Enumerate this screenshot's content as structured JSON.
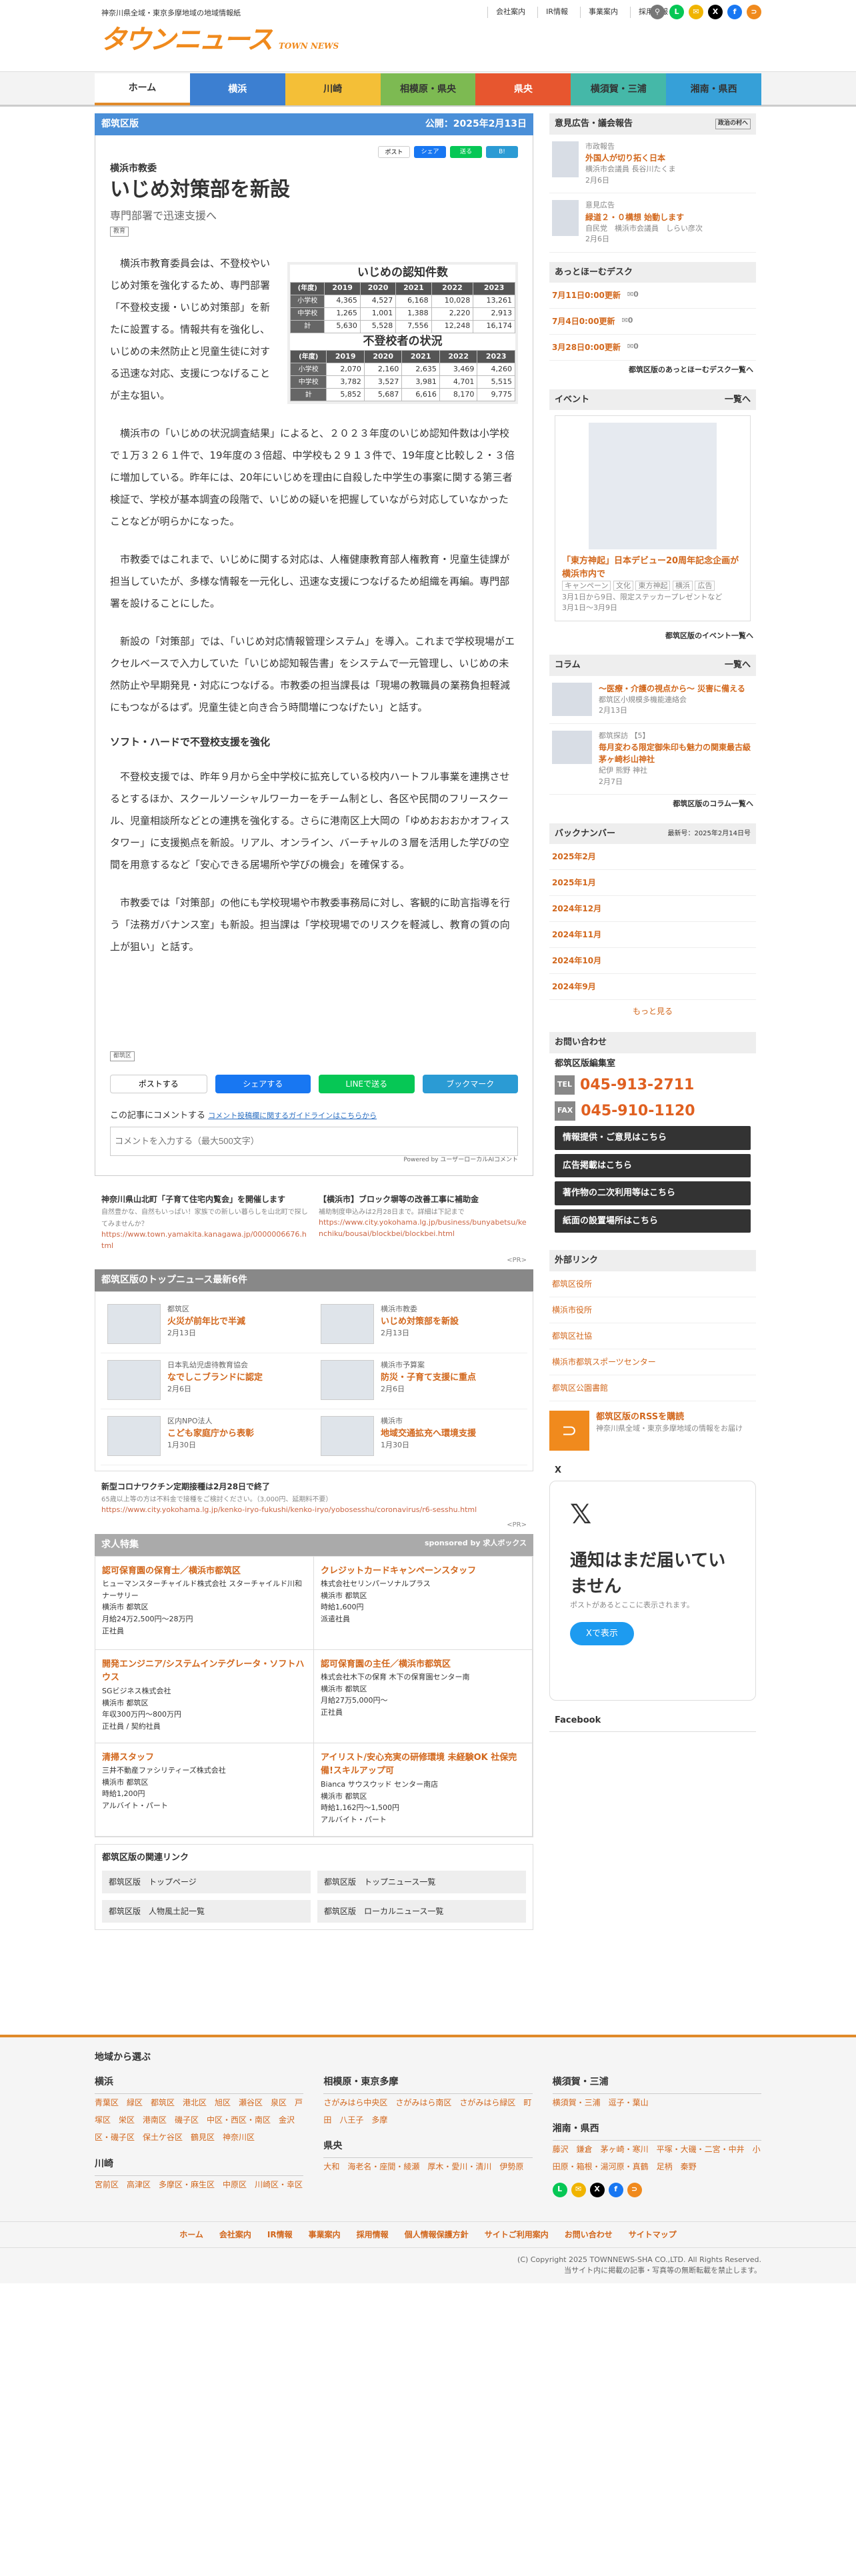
{
  "site": {
    "tagline": "神奈川県全域・東京多摩地域の地域情報紙",
    "logo": "タウンニュース",
    "logo_sub": "TOWN NEWS"
  },
  "toplinks": [
    "会社案内",
    "IR情報",
    "事業案内",
    "採用情報"
  ],
  "nav": [
    "ホーム",
    "横浜",
    "川崎",
    "相模原・県央",
    "県央",
    "横須賀・三浦",
    "湘南・県西"
  ],
  "nav_colors": [
    "#ffffff",
    "#3c7fd1",
    "#f4bf37",
    "#7dba52",
    "#e7562f",
    "#45b8a8",
    "#36a0d8"
  ],
  "article": {
    "edition": "都筑区版",
    "published": "公開：2025年2月13日",
    "share_small": [
      "ポスト",
      "シェア",
      "送る",
      "B!"
    ],
    "kicker": "横浜市教委",
    "title": "いじめ対策部を新設",
    "subtitle": "専門部署で迅速支援へ",
    "badge": "教育",
    "p1": "横浜市教育委員会は、不登校やいじめ対策を強化するため、専門部署「不登校支援・いじめ対策部」を新たに設置する。情報共有を強化し、いじめの未然防止と児童生徒に対する迅速な対応、支援につなげることが主な狙い。",
    "p2": "横浜市の「いじめの状況調査結果」によると、２０２３年度のいじめ認知件数は小学校で１万３２６１件で、19年度の３倍超、中学校も２９１３件で、19年度と比較し２・３倍に増加している。昨年には、20年にいじめを理由に自殺した中学生の事案に関する第三者検証で、学校が基本調査の段階で、いじめの疑いを把握していながら対応していなかったことなどが明らかになった。",
    "p3": "市教委ではこれまで、いじめに関する対応は、人権健康教育部人権教育・児童生徒課が担当していたが、多様な情報を一元化し、迅速な支援につなげるため組織を再編。専門部署を設けることにした。",
    "p4": "新設の「対策部」では、「いじめ対応情報管理システム」を導入。これまで学校現場がエクセルベースで入力していた「いじめ認知報告書」をシステムで一元管理し、いじめの未然防止や早期発見・対応につなげる。市教委の担当課長は「現場の教職員の業務負担軽減にもつながるはず。児童生徒と向き合う時間増につなげたい」と話す。",
    "h3": "ソフト・ハードで不登校支援を強化",
    "p5": "不登校支援では、昨年９月から全中学校に拡充している校内ハートフル事業を連携させるとするほか、スクールソーシャルワーカーをチーム制とし、各区や民間のフリースクール、児童相談所などとの連携を強化する。さらに港南区上大岡の「ゆめおおおかオフィスタワー」に支援拠点を新設。リアル、オンライン、バーチャルの３層を活用した学びの空間を用意するなど「安心できる居場所や学びの機会」を確保する。",
    "p6": "市教委では「対策部」の他にも学校現場や市教委事務局に対し、客観的に助言指導を行う「法務ガバナンス室」も新設。担当課は「学校現場でのリスクを軽減し、教育の質の向上が狙い」と話す。",
    "area_tag": "都筑区",
    "share_big": [
      "ポストする",
      "シェアする",
      "LINEで送る",
      "ブックマーク"
    ],
    "comment_label": "この記事にコメントする",
    "comment_link": "コメント投稿欄に関するガイドラインはこちらから",
    "comment_placeholder": "コメントを入力する（最大500文字）",
    "powered": "Powered by ユーザーローカルAIコメント"
  },
  "figure": {
    "title1": "いじめの認知件数",
    "title2": "不登校者の状況",
    "years": [
      "(年度)",
      "2019",
      "2020",
      "2021",
      "2022",
      "2023"
    ],
    "t1": [
      [
        "小学校",
        "4,365",
        "4,527",
        "6,168",
        "10,028",
        "13,261"
      ],
      [
        "中学校",
        "1,265",
        "1,001",
        "1,388",
        "2,220",
        "2,913"
      ],
      [
        "計",
        "5,630",
        "5,528",
        "7,556",
        "12,248",
        "16,174"
      ]
    ],
    "t2": [
      [
        "小学校",
        "2,070",
        "2,160",
        "2,635",
        "3,469",
        "4,260"
      ],
      [
        "中学校",
        "3,782",
        "3,527",
        "3,981",
        "4,701",
        "5,515"
      ],
      [
        "計",
        "5,852",
        "5,687",
        "6,616",
        "8,170",
        "9,775"
      ]
    ]
  },
  "ads": [
    {
      "title": "神奈川県山北町「子育て住宅内覧会」を開催します",
      "text": "自然豊かな、自然もいっぱい！家族での新しい暮らしを山北町で探してみませんか？",
      "url": "https://www.town.yamakita.kanagawa.jp/0000006676.html"
    },
    {
      "title": "【横浜市】ブロック塀等の改善工事に補助金",
      "text": "補助制度申込みは2月28日まで。詳細は下記まで",
      "url": "https://www.city.yokohama.lg.jp/business/bunyabetsu/kenchiku/bousai/blockbei/blockbei.html"
    }
  ],
  "pr": "<PR>",
  "topnews": {
    "head": "都筑区版のトップニュース最新6件",
    "items": [
      {
        "cat": "都筑区",
        "title": "火災が前年比で半減",
        "date": "2月13日"
      },
      {
        "cat": "横浜市教委",
        "title": "いじめ対策部を新設",
        "date": "2月13日"
      },
      {
        "cat": "日本乳幼児虐待教育協会",
        "title": "なでしこブランドに認定",
        "date": "2月6日"
      },
      {
        "cat": "横浜市予算案",
        "title": "防災・子育て支援に重点",
        "date": "2月6日"
      },
      {
        "cat": "区内NPO法人",
        "title": "こども家庭庁から表彰",
        "date": "1月30日"
      },
      {
        "cat": "横浜市",
        "title": "地域交通拡充へ環境支援",
        "date": "1月30日"
      }
    ]
  },
  "ad3": {
    "title": "新型コロナワクチン定期接種は2月28日で終了",
    "text": "65歳以上等の方は不料金で接種をご検討ください。（3,000円、延期料不要）",
    "url": "https://www.city.yokohama.lg.jp/kenko-iryo-fukushi/kenko-iryo/yobosesshu/coronavirus/r6-sesshu.html"
  },
  "jobs": {
    "head": "求人特集",
    "sponsor": "sponsored by 求人ボックス",
    "items": [
      {
        "title": "認可保育園の保育士／横浜市都筑区",
        "co": "ヒューマンスターチャイルド株式会社 スターチャイルド川和ナーサリー",
        "loc": "横浜市 都筑区",
        "pay": "月給24万2,500円～28万円",
        "type": "正社員"
      },
      {
        "title": "クレジットカードキャンペーンスタッフ",
        "co": "株式会社セリンパーソナルプラス",
        "loc": "横浜市 都筑区",
        "pay": "時給1,600円",
        "type": "派遣社員"
      },
      {
        "title": "開発エンジニア/システムインテグレータ・ソフトハウス",
        "co": "SGビジネス株式会社",
        "loc": "横浜市 都筑区",
        "pay": "年収300万円～800万円",
        "type": "正社員 / 契約社員"
      },
      {
        "title": "認可保育園の主任／横浜市都筑区",
        "co": "株式会社木下の保育 木下の保育園センター南",
        "loc": "横浜市 都筑区",
        "pay": "月給27万5,000円～",
        "type": "正社員"
      },
      {
        "title": "清掃スタッフ",
        "co": "三井不動産ファシリティーズ株式会社",
        "loc": "横浜市 都筑区",
        "pay": "時給1,200円",
        "type": "アルバイト・パート"
      },
      {
        "title": "アイリスト/安心充実の研修環境 未経験OK 社保完備!スキルアップ可",
        "co": "Bianca サウスウッド センター南店",
        "loc": "横浜市 都筑区",
        "pay": "時給1,162円～1,500円",
        "type": "アルバイト・パート"
      }
    ]
  },
  "related": {
    "head": "都筑区版の関連リンク",
    "links": [
      "都筑区版　トップページ",
      "都筑区版　トップニュース一覧",
      "都筑区版　人物風土記一覧",
      "都筑区版　ローカルニュース一覧"
    ]
  },
  "side": {
    "opinion": {
      "head": "意見広告・議会報告",
      "sub": "政治の村へ",
      "items": [
        {
          "cat": "市政報告",
          "title": "外国人が切り拓く日本",
          "by": "横浜市会議員 長谷川たくま",
          "date": "2月6日"
        },
        {
          "cat": "意見広告",
          "title": "緑道２・０構想 始動します",
          "by": "自民党　横浜市会議員　しらい彦次",
          "date": "2月6日"
        }
      ]
    },
    "desk": {
      "head": "あっとほーむデスク",
      "items": [
        {
          "t": "7月11日0:00更新",
          "n": "0"
        },
        {
          "t": "7月4日0:00更新",
          "n": "0"
        },
        {
          "t": "3月28日0:00更新",
          "n": "0"
        }
      ],
      "more": "都筑区版のあっとほーむデスク一覧へ"
    },
    "event": {
      "head": "イベント",
      "list": "一覧へ",
      "title": "「東方神起」日本デビュー20周年記念企画が横浜市内で",
      "tags": [
        "キャンペーン",
        "文化",
        "東方神起",
        "横浜",
        "広告"
      ],
      "text": "3月1日から9日、限定ステッカープレゼントなど",
      "date": "3月1日～3月9日",
      "more": "都筑区版のイベント一覧へ"
    },
    "column": {
      "head": "コラム",
      "list": "一覧へ",
      "items": [
        {
          "title": "～医療・介護の視点から～ 災害に備える",
          "by": "都筑区小規模多機能連絡会",
          "date": "2月13日"
        },
        {
          "cat": "都筑探訪 【5】",
          "title": "毎月変わる限定御朱印も魅力の関東最古級 茅ヶ崎杉山神社",
          "by": "紀伊 熊野 神社",
          "date": "2月7日"
        }
      ],
      "more": "都筑区版のコラム一覧へ"
    },
    "backnumber": {
      "head": "バックナンバー",
      "latest": "最新号：2025年2月14日号",
      "items": [
        "2025年2月",
        "2025年1月",
        "2024年12月",
        "2024年11月",
        "2024年10月",
        "2024年9月"
      ],
      "more": "もっと見る"
    },
    "contact": {
      "head": "お問い合わせ",
      "office": "都筑区版編集室",
      "tel": "045-913-2711",
      "fax": "045-910-1120",
      "buttons": [
        "情報提供・ご意見はこちら",
        "広告掲載はこちら",
        "著作物の二次利用等はこちら",
        "紙面の設置場所はこちら"
      ]
    },
    "links": {
      "head": "外部リンク",
      "items": [
        "都筑区役所",
        "横浜市役所",
        "都筑区社協",
        "横浜市都筑スポーツセンター",
        "都筑区公園書館"
      ]
    },
    "rss": {
      "title": "都筑区版のRSSを購読",
      "text": "神奈川県全域・東京多摩地域の情報をお届け"
    },
    "x": {
      "head": "X",
      "title": "通知はまだ届いていません",
      "text": "ポストがあるとここに表示されます。",
      "btn": "Xで表示"
    },
    "fb": "Facebook"
  },
  "footer": {
    "head": "地域から選ぶ",
    "yokohama": {
      "h": "横浜",
      "items": "青葉区　緑区　都筑区　港北区　旭区　瀬谷区　泉区　戸塚区　栄区　港南区　磯子区　中区・西区・南区　金沢区・磯子区　保土ケ谷区　鶴見区　神奈川区"
    },
    "kawasaki": {
      "h": "川崎",
      "items": "宮前区　高津区　多摩区・麻生区　中原区　川崎区・幸区"
    },
    "sagami": {
      "h": "相模原・東京多摩",
      "items": "さがみはら中央区　さがみはら南区　さがみはら緑区　町田　八王子　多摩"
    },
    "kenou": {
      "h": "県央",
      "items": "大和　海老名・座間・綾瀬　厚木・愛川・清川　伊勢原"
    },
    "yokosuka": {
      "h": "横須賀・三浦",
      "items": "横須賀・三浦　逗子・葉山"
    },
    "shonan": {
      "h": "湘南・県西",
      "items": "藤沢　鎌倉　茅ヶ崎・寒川　平塚・大磯・二宮・中井　小田原・箱根・湯河原・真鶴　足柄　秦野"
    },
    "links": [
      "ホーム",
      "会社案内",
      "IR情報",
      "事業案内",
      "採用情報",
      "個人情報保護方針",
      "サイトご利用案内",
      "お問い合わせ",
      "サイトマップ"
    ],
    "copy": "(C) Copyright 2025 TOWNNEWS-SHA CO.,LTD. All Rights Reserved.",
    "copy2": "当サイト内に掲載の記事・写真等の無断転載を禁止します。"
  }
}
